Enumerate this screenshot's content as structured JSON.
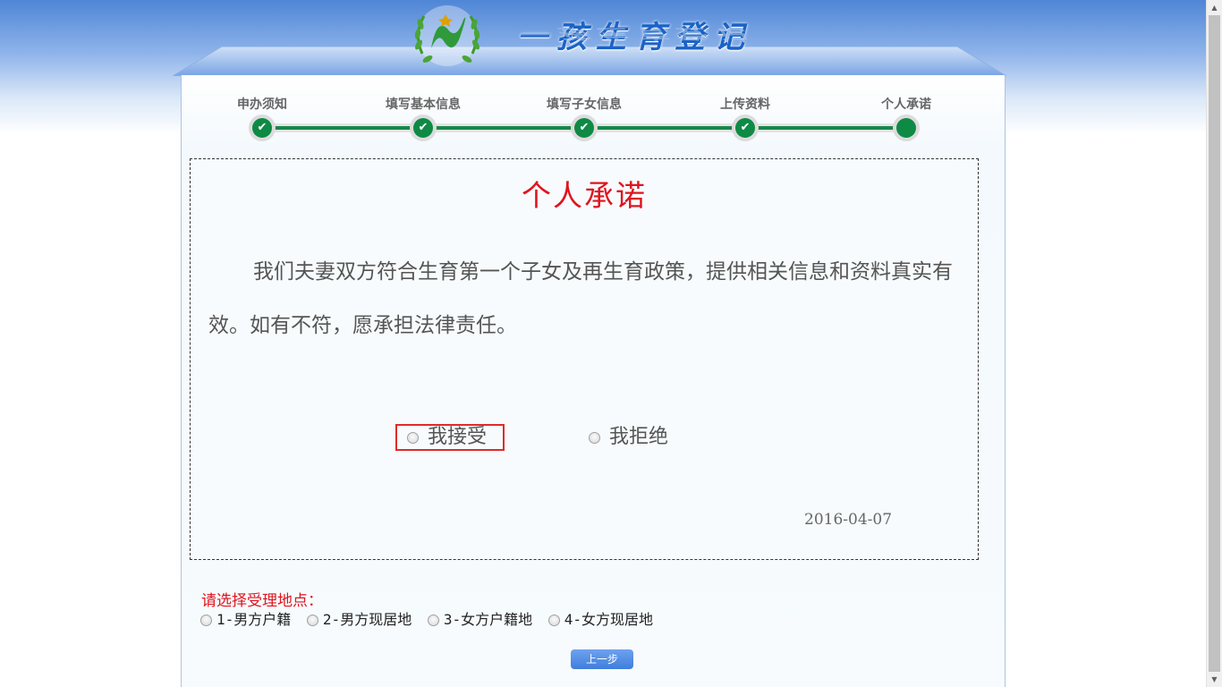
{
  "brand": {
    "title": "一孩生育登记",
    "logo_icon": "laurel-wreath-logo-icon"
  },
  "steps": [
    {
      "label": "申办须知",
      "status": "done"
    },
    {
      "label": "填写基本信息",
      "status": "done"
    },
    {
      "label": "填写子女信息",
      "status": "done"
    },
    {
      "label": "上传资料",
      "status": "done"
    },
    {
      "label": "个人承诺",
      "status": "current"
    }
  ],
  "step_check": "✔",
  "promise": {
    "title": "个人承诺",
    "text": "我们夫妻双方符合生育第一个子女及再生育政策，提供相关信息和资料真实有效。如有不符，愿承担法律责任。",
    "accept_label": "我接受",
    "reject_label": "我拒绝",
    "date": "2016-04-07"
  },
  "location": {
    "prompt": "请选择受理地点：",
    "options": [
      "1-男方户籍",
      "2-男方现居地",
      "3-女方户籍地",
      "4-女方现居地"
    ]
  },
  "nav": {
    "prev_label": "上一步"
  },
  "colors": {
    "accent_red": "#e0141e",
    "step_green": "#0e8a45",
    "button_blue": "#3f7ddd"
  }
}
